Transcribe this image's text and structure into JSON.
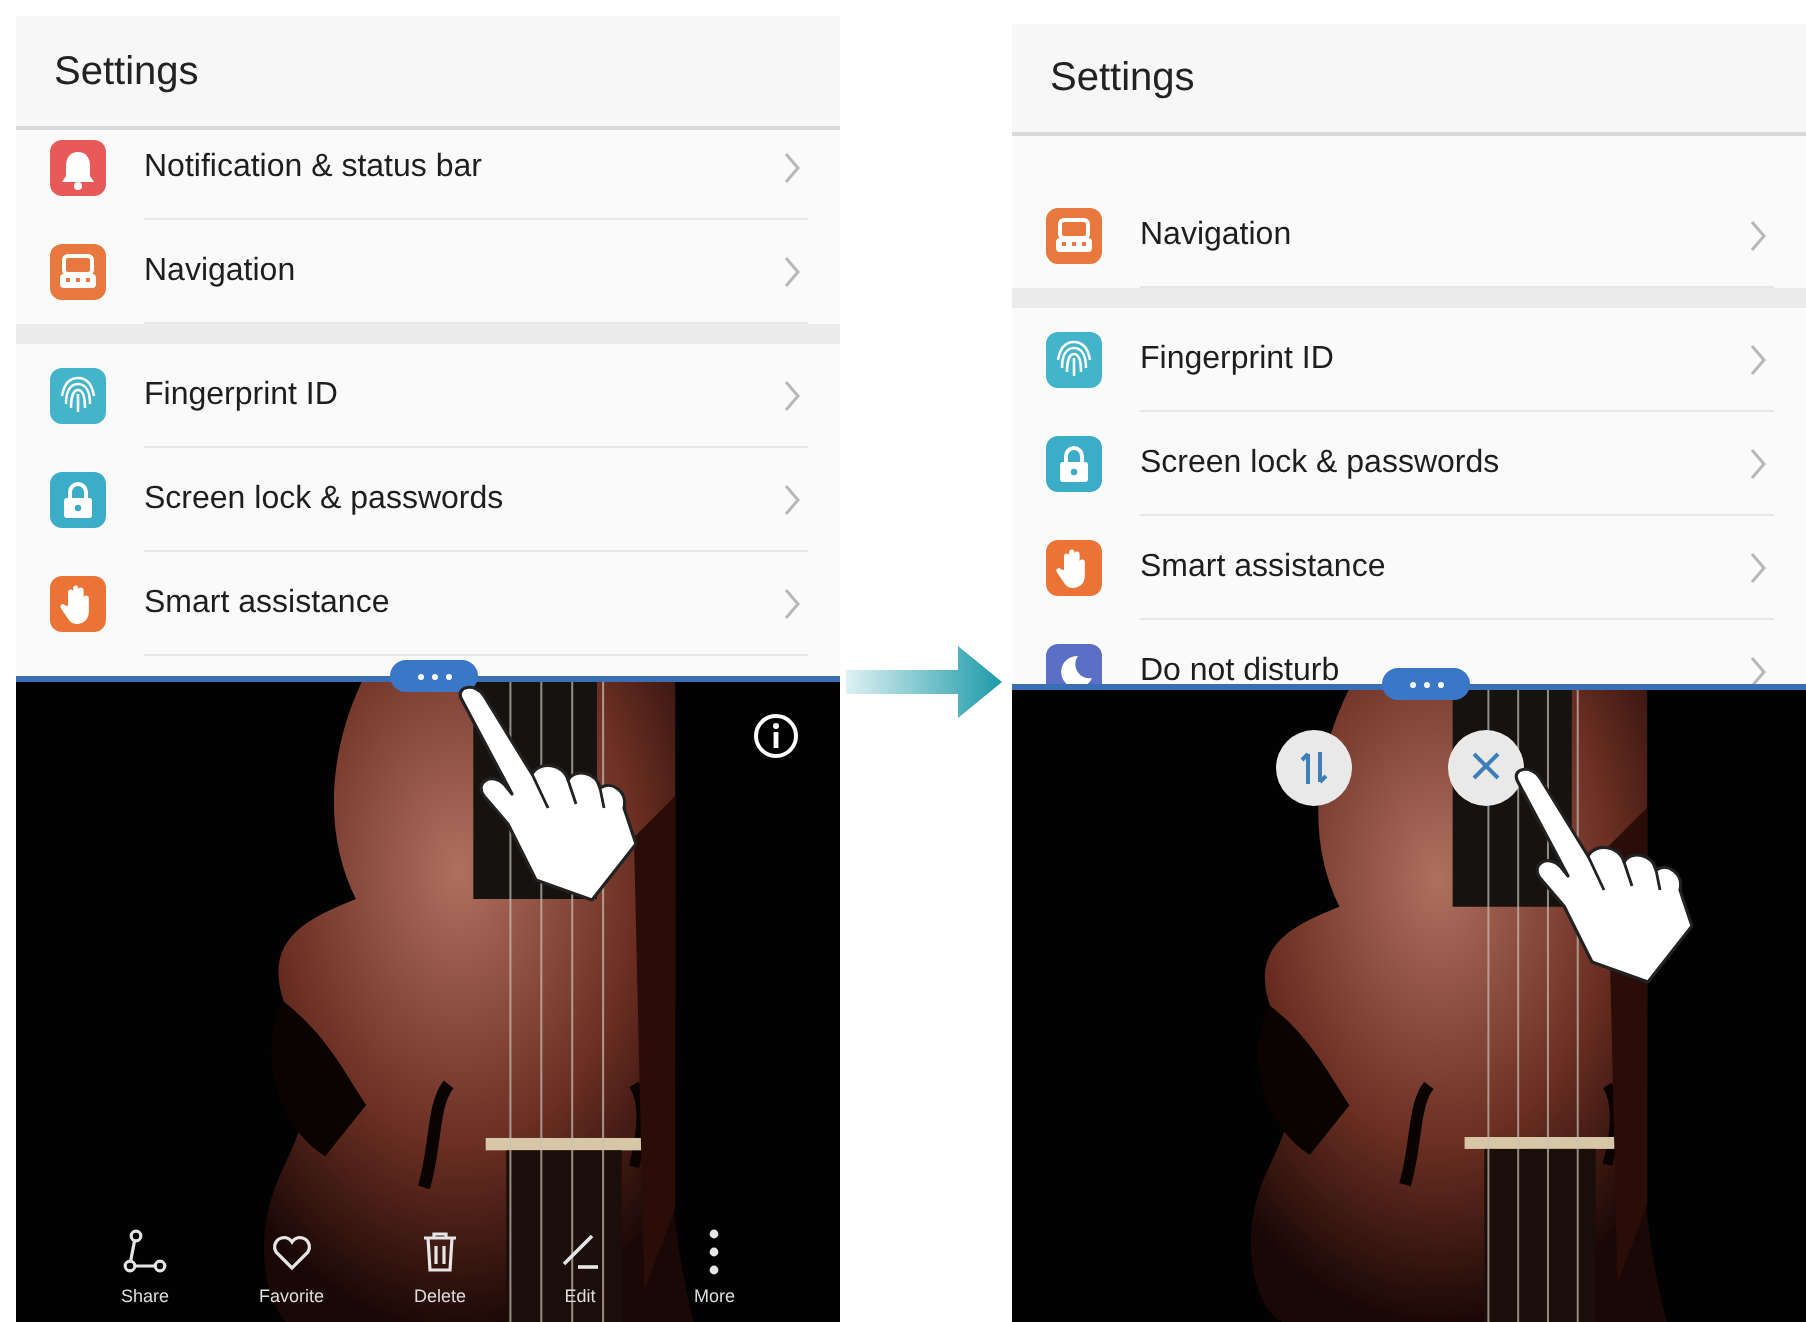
{
  "screens": [
    {
      "title": "Settings",
      "sections": [
        {
          "items": [
            {
              "label": "Notification & status bar",
              "kind": "bell",
              "color": "#e85a57"
            },
            {
              "label": "Navigation",
              "kind": "navigation",
              "color": "#e9783f"
            }
          ]
        },
        {
          "items": [
            {
              "label": "Fingerprint ID",
              "kind": "fingerprint",
              "color": "#43b4c9"
            },
            {
              "label": "Screen lock & passwords",
              "kind": "lock",
              "color": "#3badc9"
            },
            {
              "label": "Smart assistance",
              "kind": "hand",
              "color": "#ec7336"
            }
          ]
        }
      ],
      "info_button": true,
      "toolbar": [
        {
          "label": "Share",
          "kind": "share"
        },
        {
          "label": "Favorite",
          "kind": "heart"
        },
        {
          "label": "Delete",
          "kind": "trash"
        },
        {
          "label": "Edit",
          "kind": "pencil"
        },
        {
          "label": "More",
          "kind": "dots"
        }
      ]
    },
    {
      "title": "Settings",
      "sections": [
        {
          "items": [
            {
              "label": "Navigation",
              "kind": "navigation",
              "color": "#e9783f"
            }
          ]
        },
        {
          "items": [
            {
              "label": "Fingerprint ID",
              "kind": "fingerprint",
              "color": "#43b4c9"
            },
            {
              "label": "Screen lock & passwords",
              "kind": "lock",
              "color": "#3badc9"
            },
            {
              "label": "Smart assistance",
              "kind": "hand",
              "color": "#ec7336"
            },
            {
              "label": "Do not disturb",
              "kind": "moon",
              "color": "#5b6fc7"
            }
          ]
        }
      ],
      "split_buttons": [
        {
          "kind": "swap"
        },
        {
          "kind": "close"
        }
      ]
    }
  ]
}
